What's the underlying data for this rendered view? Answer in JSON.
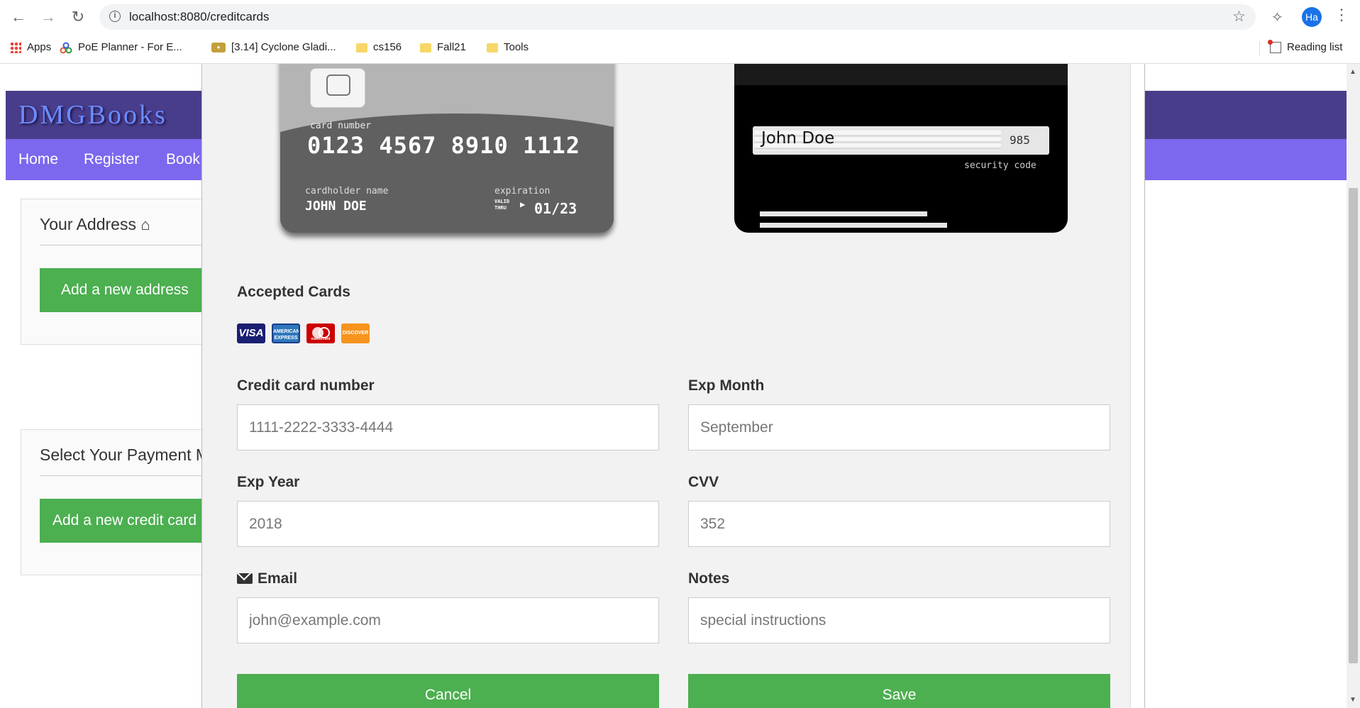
{
  "browser": {
    "url": "localhost:8080/creditcards",
    "profile_initials": "Ha",
    "bookmarks": [
      "Apps",
      "PoE Planner - For E...",
      "[3.14] Cyclone Gladi...",
      "cs156",
      "Fall21",
      "Tools"
    ],
    "reading_list": "Reading list"
  },
  "site": {
    "brand": "DMGBooks",
    "nav": [
      "Home",
      "Register",
      "Book"
    ],
    "address_panel": {
      "title": "Your Address",
      "button": "Add a new address"
    },
    "payment_panel": {
      "title": "Select Your Payment Method",
      "button": "Add a new credit card"
    }
  },
  "card_front": {
    "number_label": "card number",
    "number": "0123 4567 8910 1112",
    "holder_label": "cardholder name",
    "holder": "JOHN DOE",
    "expiration_label": "expiration",
    "valid_thru": "VALID THRU",
    "expiration": "01/23"
  },
  "card_back": {
    "signature": "John Doe",
    "cvc": "985",
    "security_label": "security code"
  },
  "form": {
    "accepted_title": "Accepted Cards",
    "cards": [
      "VISA",
      "AMERICAN EXPRESS",
      "mastercard",
      "DISCOVER"
    ],
    "cc_number_label": "Credit card number",
    "cc_number_placeholder": "1111-2222-3333-4444",
    "exp_month_label": "Exp Month",
    "exp_month_placeholder": "September",
    "exp_year_label": "Exp Year",
    "exp_year_placeholder": "2018",
    "cvv_label": "CVV",
    "cvv_placeholder": "352",
    "email_label": "Email",
    "email_placeholder": "john@example.com",
    "notes_label": "Notes",
    "notes_placeholder": "special instructions",
    "cancel_label": "Cancel",
    "save_label": "Save"
  },
  "colors": {
    "banner": "#483d8b",
    "navbar": "#7b68ee",
    "button_green": "#4caf50",
    "brand_text": "#6c8cff"
  }
}
